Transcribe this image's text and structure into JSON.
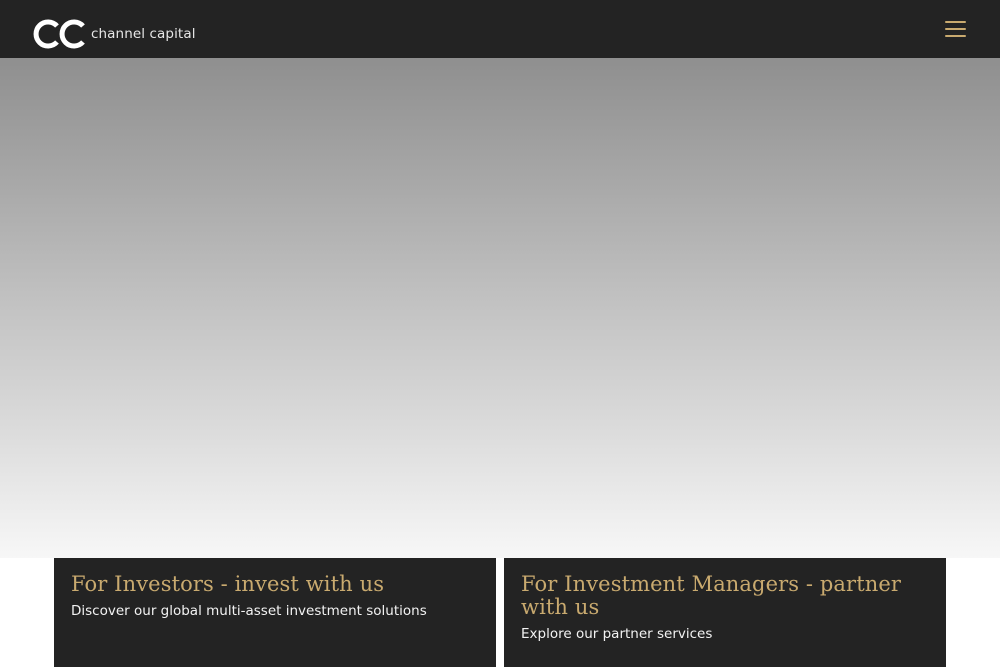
{
  "header": {
    "brand_name": "channel capital",
    "logo_icon": "cc-logo-icon",
    "menu_icon": "hamburger-menu-icon"
  },
  "cards": [
    {
      "title": "For Investors - invest with us",
      "text": "Discover our global multi-asset investment solutions"
    },
    {
      "title": "For Investment Managers - partner with us",
      "text": "Explore our partner services"
    }
  ],
  "colors": {
    "header_bg": "#232323",
    "accent_gold": "#c9aa6f",
    "card_bg": "#232323"
  }
}
